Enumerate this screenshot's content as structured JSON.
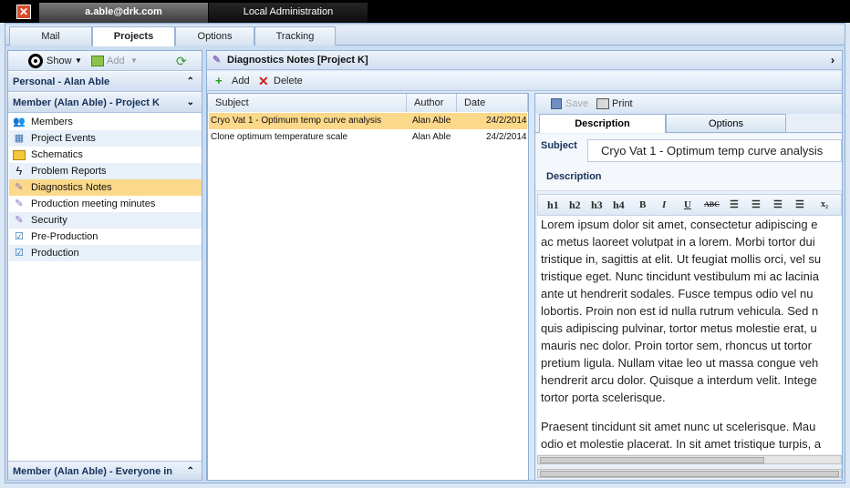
{
  "titlebar": {
    "close_label": "✕",
    "user_tab": "a.able@drk.com",
    "local_tab": "Local Administration"
  },
  "main_tabs": [
    {
      "label": "Mail"
    },
    {
      "label": "Projects"
    },
    {
      "label": "Options"
    },
    {
      "label": "Tracking"
    }
  ],
  "left": {
    "show_label": "Show",
    "add_label": "Add",
    "personal_header": "Personal - Alan Able",
    "member_header": "Member (Alan Able) - Project K",
    "bottom_header": "Member (Alan Able) - Everyone in",
    "items": [
      {
        "label": "Members",
        "icon": "members-icon"
      },
      {
        "label": "Project Events",
        "icon": "calendar-icon"
      },
      {
        "label": "Schematics",
        "icon": "folder-icon"
      },
      {
        "label": "Problem Reports",
        "icon": "lightning-icon"
      },
      {
        "label": "Diagnostics Notes",
        "icon": "note-icon"
      },
      {
        "label": "Production meeting minutes",
        "icon": "note-icon"
      },
      {
        "label": "Security",
        "icon": "note-icon"
      },
      {
        "label": "Pre-Production",
        "icon": "checklist-icon"
      },
      {
        "label": "Production",
        "icon": "checklist-icon"
      }
    ]
  },
  "center": {
    "header": "Diagnostics Notes [Project K]",
    "add_label": "Add",
    "delete_label": "Delete",
    "columns": {
      "subject": "Subject",
      "author": "Author",
      "date": "Date"
    },
    "rows": [
      {
        "subject": "Cryo Vat 1 - Optimum temp curve analysis",
        "author": "Alan Able",
        "date": "24/2/2014"
      },
      {
        "subject": "Clone optimum temperature scale",
        "author": "Alan Able",
        "date": "24/2/2014"
      }
    ]
  },
  "detail": {
    "save_label": "Save",
    "print_label": "Print",
    "tab_description": "Description",
    "tab_options": "Options",
    "subject_label": "Subject",
    "subject_value": "Cryo Vat 1 - Optimum  temp curve analysis",
    "description_label": "Description",
    "rte": {
      "h1": "h1",
      "h2": "h2",
      "h3": "h3",
      "h4": "h4",
      "bold": "B",
      "italic": "I",
      "underline": "U",
      "strike": "ABC",
      "subscript": "x₂"
    },
    "paragraph1": [
      "Lorem ipsum dolor sit amet, consectetur adipiscing e",
      "ac metus laoreet volutpat in a lorem. Morbi tortor dui",
      "tristique in, sagittis at elit. Ut feugiat mollis orci, vel su",
      "tristique eget. Nunc tincidunt vestibulum mi ac lacinia",
      "ante ut hendrerit sodales. Fusce tempus odio vel nu",
      "lobortis. Proin non est id nulla rutrum vehicula. Sed n",
      "quis adipiscing pulvinar, tortor metus molestie erat, u",
      "mauris nec dolor. Proin tortor sem, rhoncus ut tortor",
      "pretium ligula. Nullam vitae leo ut massa congue veh",
      "hendrerit arcu dolor. Quisque a interdum velit. Intege",
      "tortor porta scelerisque."
    ],
    "paragraph2": [
      "Praesent tincidunt sit amet nunc ut scelerisque. Mau",
      "odio et molestie placerat. In sit amet tristique turpis, a"
    ]
  },
  "colors": {
    "accent": "#15325a",
    "selection": "#fcd88a",
    "chrome": "#cbdcf0"
  }
}
